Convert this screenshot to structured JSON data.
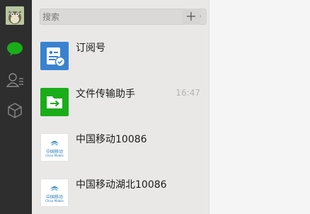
{
  "sidebar": {
    "avatar": "user-avatar",
    "nav": [
      "chat-bubble-icon",
      "contacts-icon",
      "favorites-cube-icon"
    ],
    "active_color": "#1aad19"
  },
  "search": {
    "placeholder": "搜索",
    "value": ""
  },
  "chats": [
    {
      "name": "订阅号",
      "time": "",
      "icon": "subscription-icon",
      "icon_bg": "#3a82d0"
    },
    {
      "name": "文件传输助手",
      "time": "16:47",
      "icon": "file-transfer-icon",
      "icon_bg": "#1aad19"
    },
    {
      "name": "中国移动10086",
      "time": "",
      "icon": "china-mobile-logo",
      "logo_cn": "中国移动",
      "logo_en": "China Mobile"
    },
    {
      "name": "中国移动湖北10086",
      "time": "",
      "icon": "china-mobile-logo",
      "logo_cn": "中国移动",
      "logo_en": "China Mobile"
    }
  ]
}
